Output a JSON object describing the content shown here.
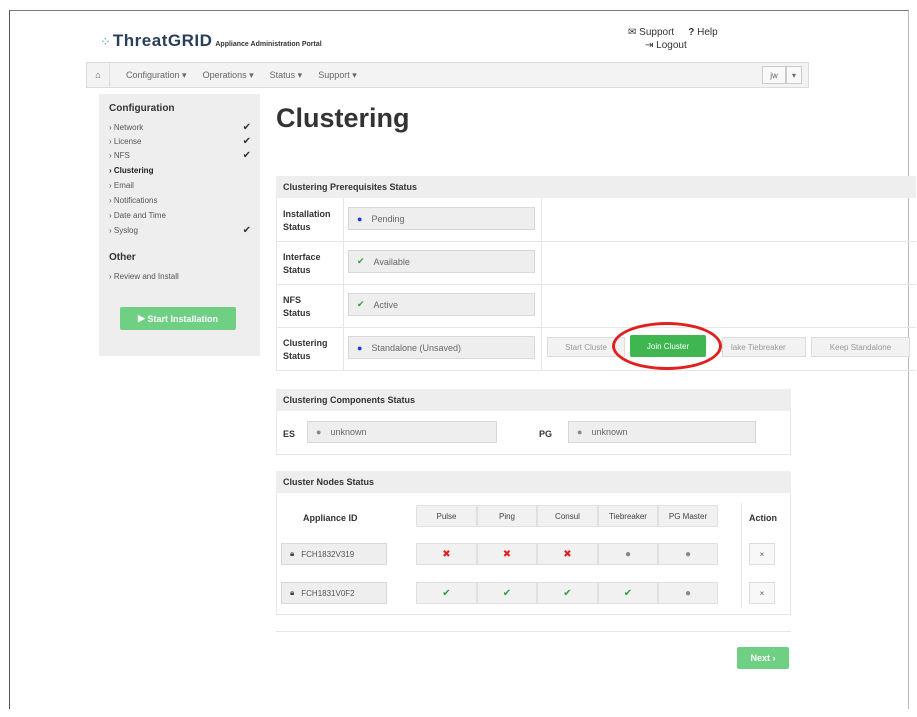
{
  "app": {
    "logo": "ThreatGRID",
    "subtitle": "Appliance Administration Portal",
    "support": "Support",
    "help": "Help",
    "logout": "Logout"
  },
  "navbar": {
    "items": [
      "Configuration",
      "Operations",
      "Status",
      "Support"
    ],
    "user": "jw"
  },
  "sidebar": {
    "config_heading": "Configuration",
    "items": [
      {
        "label": "Network",
        "checked": true
      },
      {
        "label": "License",
        "checked": true
      },
      {
        "label": "NFS",
        "checked": true
      },
      {
        "label": "Clustering",
        "checked": false
      },
      {
        "label": "Email",
        "checked": false
      },
      {
        "label": "Notifications",
        "checked": false
      },
      {
        "label": "Date and Time",
        "checked": false
      },
      {
        "label": "Syslog",
        "checked": true
      }
    ],
    "other_heading": "Other",
    "other_items": [
      {
        "label": "Review and Install"
      }
    ],
    "start_button": "Start Installation"
  },
  "page": {
    "title": "Clustering"
  },
  "prereq": {
    "heading": "Clustering Prerequisites Status",
    "rows": [
      {
        "label": "Installation Status",
        "value": "Pending",
        "icon": "dot-blue"
      },
      {
        "label": "Interface Status",
        "value": "Available",
        "icon": "check-green"
      },
      {
        "label": "NFS Status",
        "value": "Active",
        "icon": "check-green"
      },
      {
        "label": "Clustering Status",
        "value": "Standalone (Unsaved)",
        "icon": "dot-blue"
      }
    ],
    "buttons": {
      "start_cluster": "Start Cluste",
      "join_cluster": "Join Cluster",
      "make_tiebreaker": "lake Tiebreaker",
      "keep_standalone": "Keep Standalone"
    }
  },
  "components": {
    "heading": "Clustering Components Status",
    "es_label": "ES",
    "es_value": "unknown",
    "pg_label": "PG",
    "pg_value": "unknown"
  },
  "nodes": {
    "heading": "Cluster Nodes Status",
    "id_header": "Appliance ID",
    "columns": [
      "Pulse",
      "Ping",
      "Consul",
      "Tiebreaker",
      "PG Master"
    ],
    "action_header": "Action",
    "rows": [
      {
        "id": "FCH1832V319",
        "status": [
          "x",
          "x",
          "x",
          "dot",
          "dot"
        ],
        "action": "×"
      },
      {
        "id": "FCH1831V0F2",
        "status": [
          "check",
          "check",
          "check",
          "check",
          "dot"
        ],
        "action": "×"
      }
    ]
  },
  "next_button": "Next",
  "colors": {
    "accent_green": "#3fb650",
    "light_green": "#6fcf83",
    "highlight_red": "#e0211f",
    "pending_blue": "#1a3fd6"
  }
}
